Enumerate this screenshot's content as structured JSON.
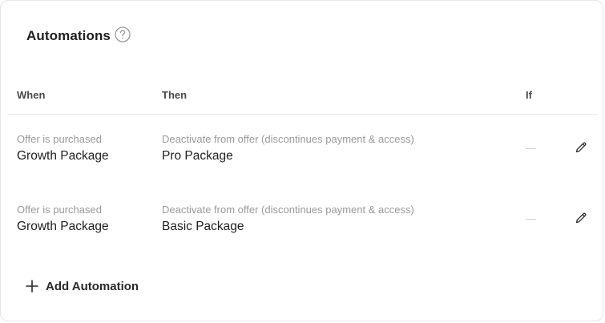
{
  "header": {
    "title": "Automations"
  },
  "table": {
    "columns": {
      "when": "When",
      "then": "Then",
      "if": "If"
    },
    "rows": [
      {
        "when_label": "Offer is purchased",
        "when_value": "Growth Package",
        "then_label": "Deactivate from offer (discontinues payment & access)",
        "then_value": "Pro Package",
        "if_value": "—"
      },
      {
        "when_label": "Offer is purchased",
        "when_value": "Growth Package",
        "then_label": "Deactivate from offer (discontinues payment & access)",
        "then_value": "Basic Package",
        "if_value": "—"
      }
    ]
  },
  "actions": {
    "add_automation_label": "Add Automation"
  },
  "icons": {
    "help": "help-circle-icon",
    "edit": "pencil-icon",
    "add": "plus-icon"
  },
  "colors": {
    "text_primary": "#1f1f1f",
    "text_muted": "#9a9a9a",
    "border": "#e6e6e6"
  }
}
